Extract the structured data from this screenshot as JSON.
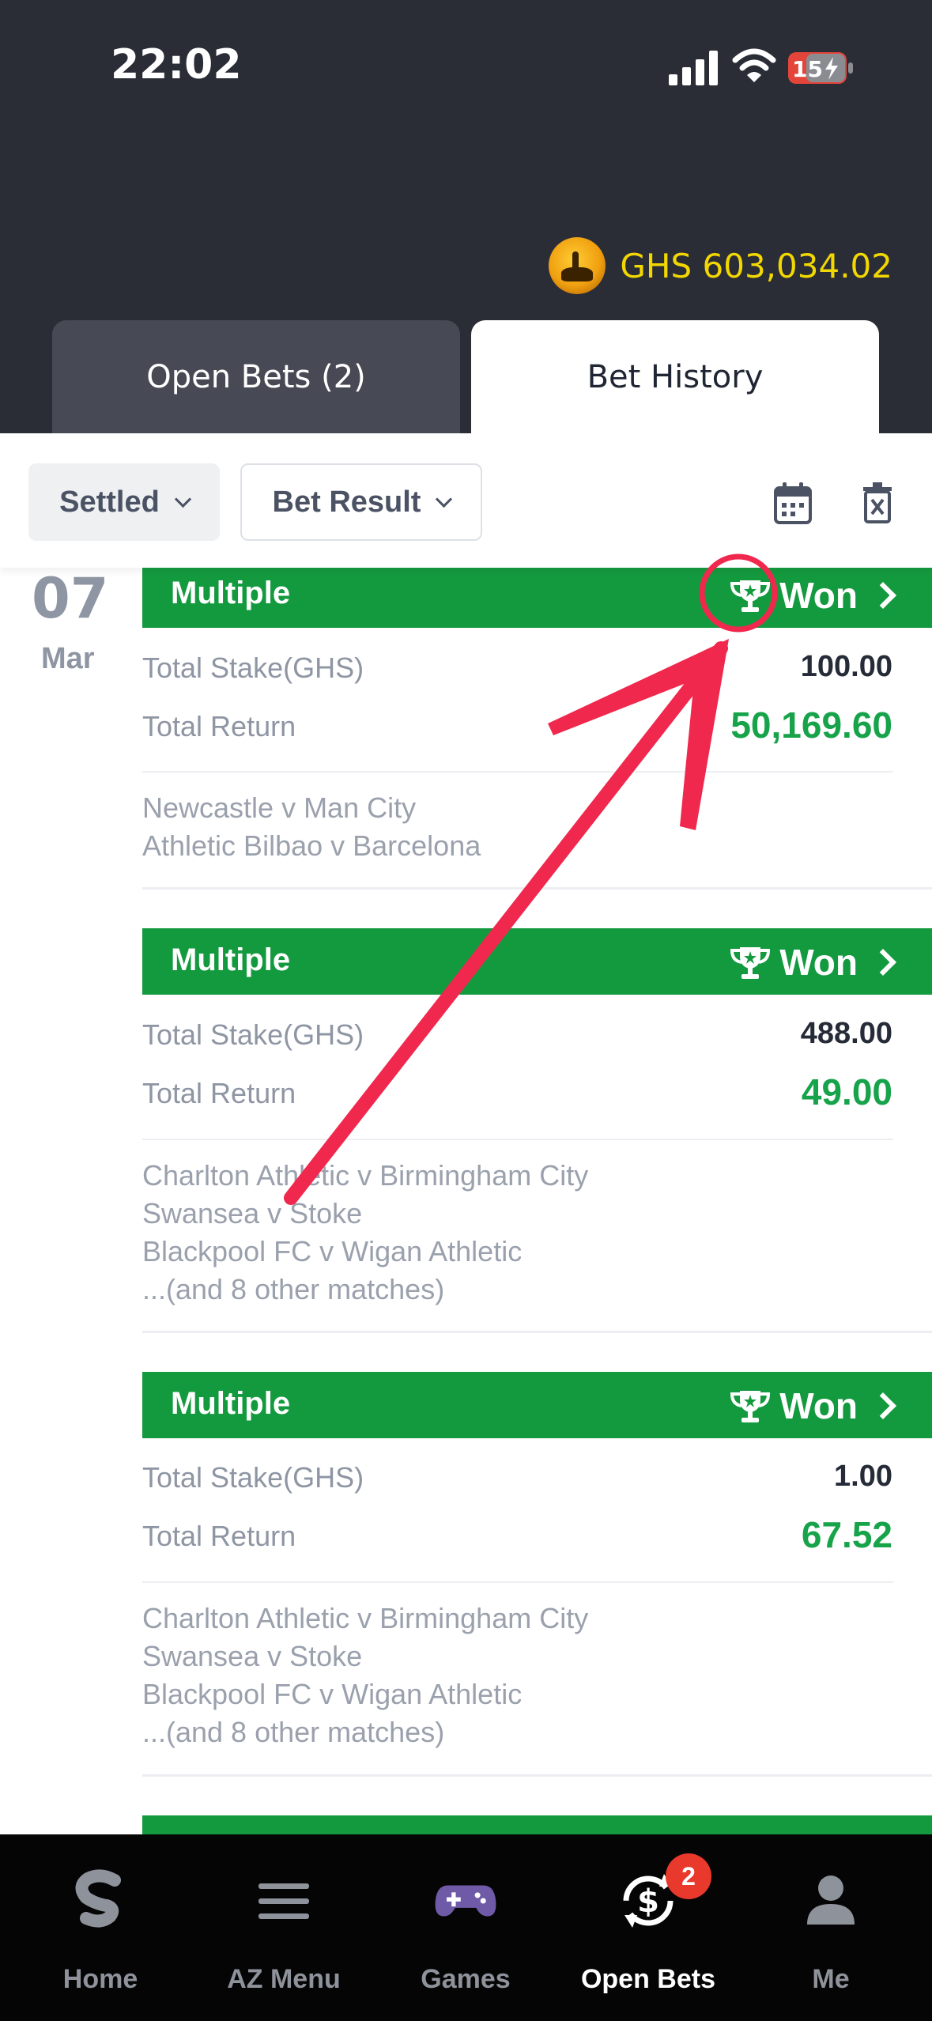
{
  "status_bar": {
    "time": "22:02",
    "battery": "15"
  },
  "header": {
    "balance": "GHS 603,034.02"
  },
  "tabs": [
    {
      "label": "Open Bets (2)",
      "active": false
    },
    {
      "label": "Bet History",
      "active": true
    }
  ],
  "filters": {
    "status": "Settled",
    "result": "Bet Result"
  },
  "date": {
    "day": "07",
    "month": "Mar"
  },
  "bets": [
    {
      "type": "Multiple",
      "result": "Won",
      "stake_label": "Total Stake(GHS)",
      "stake": "100.00",
      "return_label": "Total Return",
      "return": "50,169.60",
      "matches": [
        "Newcastle v Man City",
        "Athletic Bilbao v Barcelona"
      ]
    },
    {
      "type": "Multiple",
      "result": "Won",
      "stake_label": "Total Stake(GHS)",
      "stake": "488.00",
      "return_label": "Total Return",
      "return": "49.00",
      "matches": [
        "Charlton Athletic v Birmingham City",
        "Swansea v Stoke",
        "Blackpool FC v Wigan Athletic",
        "...(and 8 other matches)"
      ]
    },
    {
      "type": "Multiple",
      "result": "Won",
      "stake_label": "Total Stake(GHS)",
      "stake": "1.00",
      "return_label": "Total Return",
      "return": "67.52",
      "matches": [
        "Charlton Athletic v Birmingham City",
        "Swansea v Stoke",
        "Blackpool FC v Wigan Athletic",
        "...(and 8 other matches)"
      ]
    }
  ],
  "nav": [
    {
      "label": "Home",
      "icon": "sporty-logo-icon",
      "active": false
    },
    {
      "label": "AZ Menu",
      "icon": "hamburger-menu-icon",
      "active": false
    },
    {
      "label": "Games",
      "icon": "gamepad-icon",
      "active": false
    },
    {
      "label": "Open Bets",
      "icon": "open-bets-icon",
      "active": true,
      "badge": "2"
    },
    {
      "label": "Me",
      "icon": "user-icon",
      "active": false
    }
  ],
  "colors": {
    "header_bg": "#2a2d36",
    "won_green": "#149a3e",
    "return_green": "#17a34a",
    "annotation_red": "#f0284e",
    "balance_yellow": "#f2d700"
  }
}
